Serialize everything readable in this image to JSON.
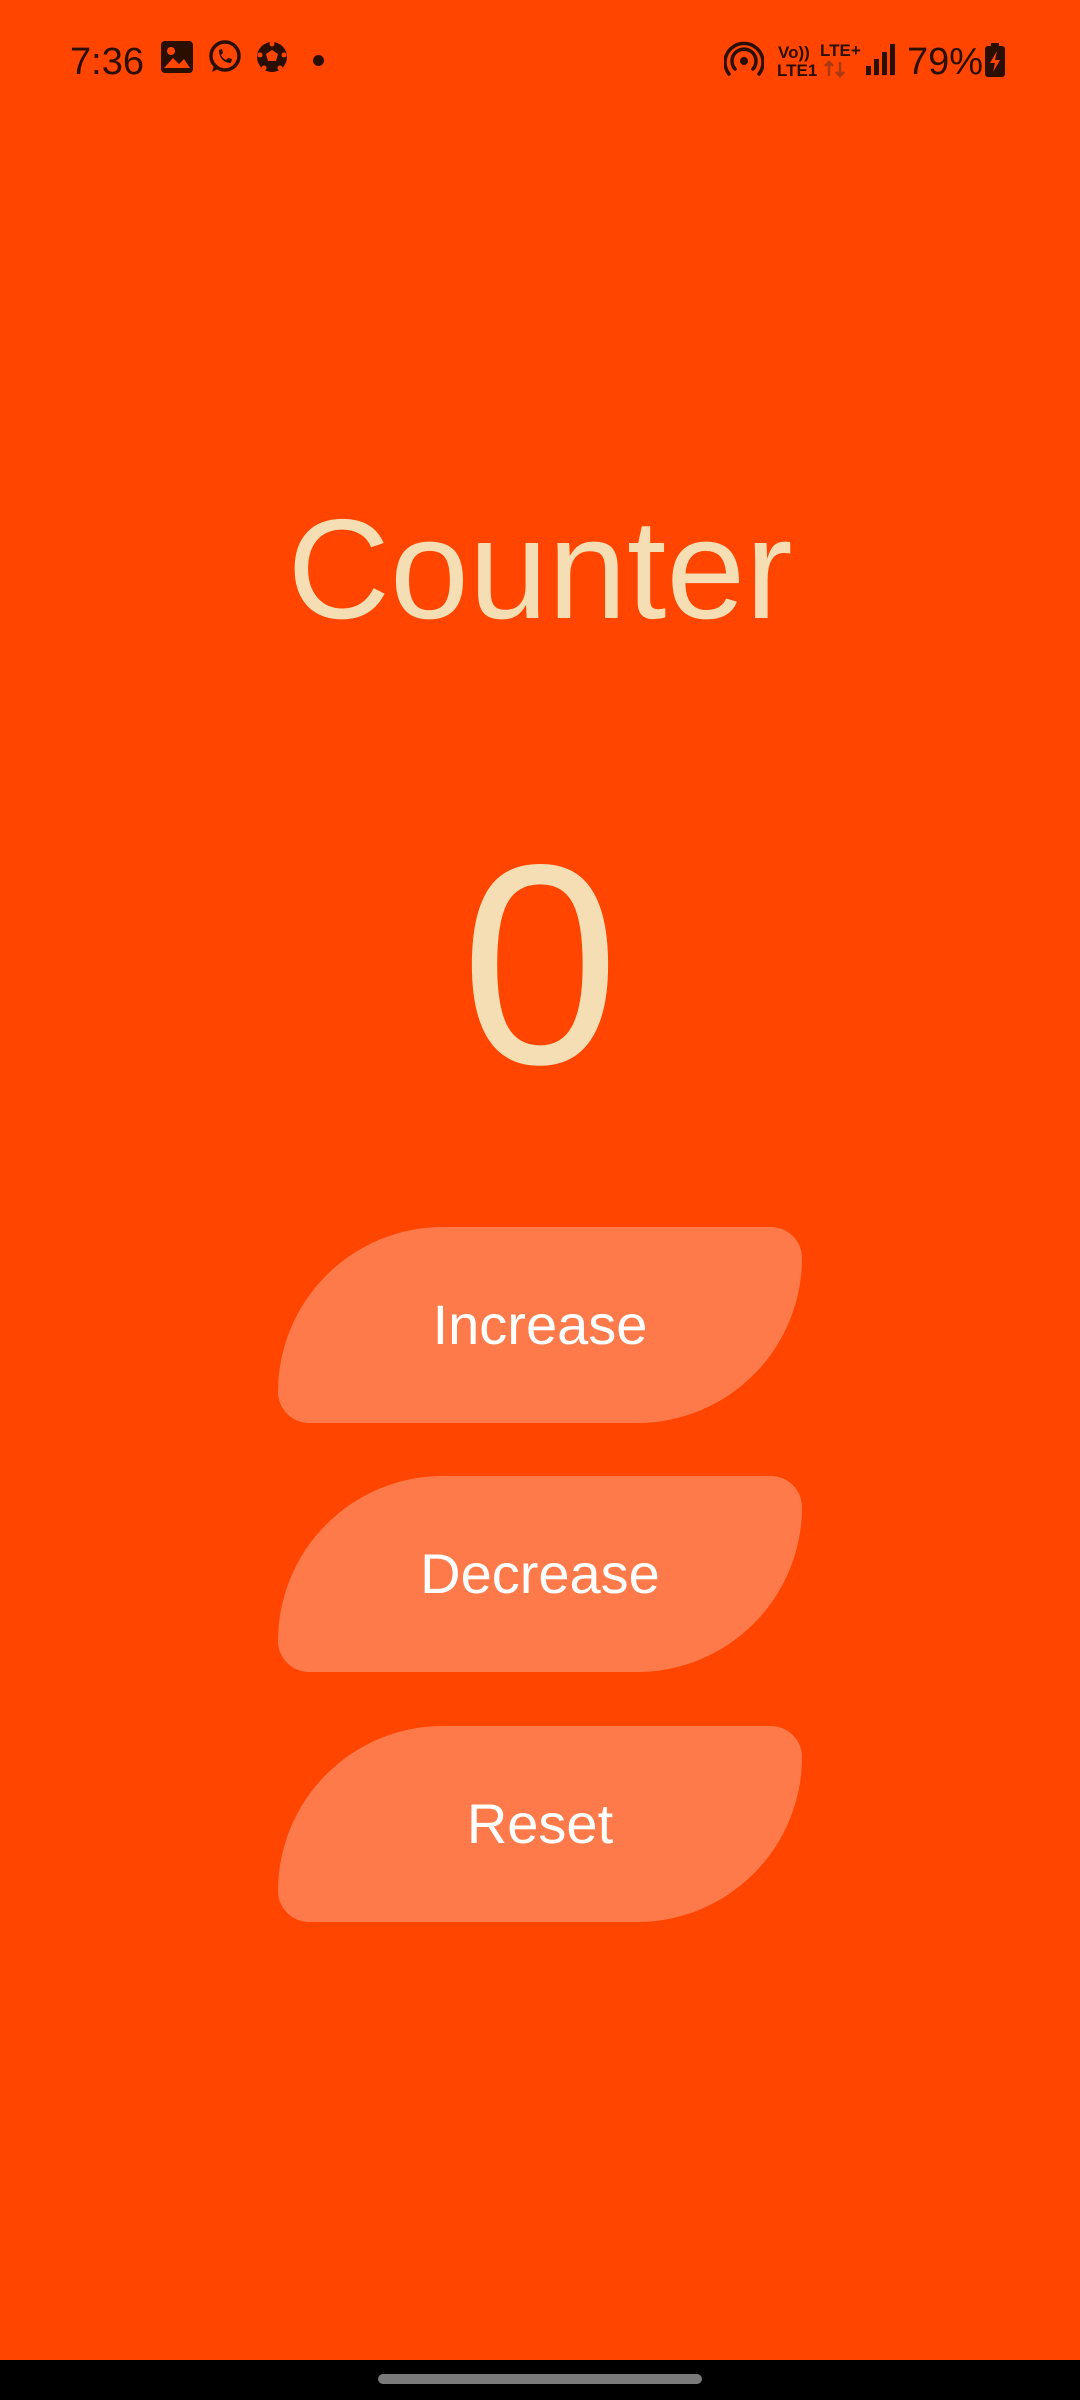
{
  "status_bar": {
    "time": "7:36",
    "notification_icons": [
      "gallery-icon",
      "whatsapp-icon",
      "soccer-ball-icon"
    ],
    "network_volte": "Vo))",
    "network_lte_top": "LTE+",
    "network_lte_bottom": "LTE1",
    "battery_percent": "79%"
  },
  "app": {
    "title": "Counter",
    "count": "0",
    "background_color": "#FF4500",
    "text_color": "#F5DEB3",
    "button_color": "#FF7A4A"
  },
  "buttons": {
    "increase": "Increase",
    "decrease": "Decrease",
    "reset": "Reset"
  }
}
